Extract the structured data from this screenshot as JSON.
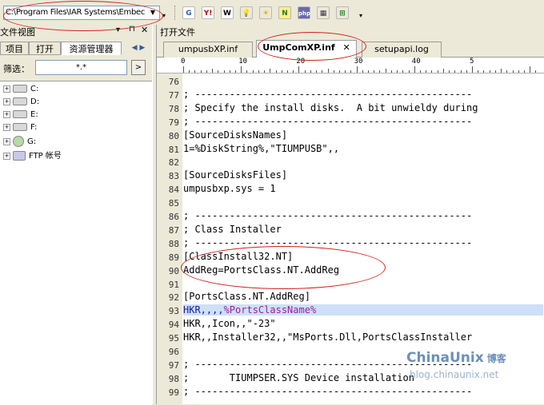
{
  "toolbar": {
    "path_value": "C:\\Program Files\\IAR Systems\\Embec",
    "icons": [
      {
        "name": "google-icon",
        "glyph": "G",
        "color": "#2a5db0",
        "bg": "#fff"
      },
      {
        "name": "yahoo-icon",
        "glyph": "Y!",
        "color": "#cc0000",
        "bg": "#fff"
      },
      {
        "name": "wikipedia-icon",
        "glyph": "W",
        "color": "#000",
        "bg": "#fff"
      },
      {
        "name": "lightbulb-icon",
        "glyph": "💡",
        "color": "#c8a000",
        "bg": "#ece9d8"
      },
      {
        "name": "weather-icon",
        "glyph": "☀",
        "color": "#e0a000",
        "bg": "#ece9d8"
      },
      {
        "name": "notes-icon",
        "glyph": "N",
        "color": "#2a7a2a",
        "bg": "#ffef8a"
      },
      {
        "name": "php-icon",
        "glyph": "php",
        "color": "#fff",
        "bg": "#6a6aa8"
      },
      {
        "name": "msdn-icon",
        "glyph": "▦",
        "color": "#334",
        "bg": "#ece9d8"
      },
      {
        "name": "windows-icon",
        "glyph": "⊞",
        "color": "#1a7a1a",
        "bg": "#ece9d8"
      }
    ]
  },
  "left_panel": {
    "title": "文件视图",
    "title_controls": [
      "▾",
      "⊓",
      "✕"
    ],
    "tabs": [
      "项目",
      "打开",
      "资源管理器"
    ],
    "nav_arrows": "◀ ▶",
    "filter_label": "筛选：",
    "filter_value": "*.*",
    "filter_button": ">",
    "tree": [
      {
        "label": "C:",
        "type": "drive"
      },
      {
        "label": "D:",
        "type": "drive"
      },
      {
        "label": "E:",
        "type": "drive"
      },
      {
        "label": "F:",
        "type": "drive"
      },
      {
        "label": "G:",
        "type": "network"
      },
      {
        "label": "FTP 帐号",
        "type": "ftp"
      }
    ]
  },
  "right_panel": {
    "title": "打开文件",
    "tabs": [
      {
        "label": "umpusbXP.inf",
        "active": false
      },
      {
        "label": "UmpComXP.inf",
        "active": true,
        "close": "✕"
      },
      {
        "label": "setupapi.log",
        "active": false
      }
    ],
    "ruler_labels": [
      "0",
      "10",
      "20",
      "30",
      "40",
      "5"
    ],
    "lines": [
      {
        "n": "76",
        "text": ""
      },
      {
        "n": "77",
        "text": "; ------------------------------------------------"
      },
      {
        "n": "78",
        "text": "; Specify the install disks.  A bit unwieldy during"
      },
      {
        "n": "79",
        "text": "; ------------------------------------------------"
      },
      {
        "n": "80",
        "text": "[SourceDisksNames]"
      },
      {
        "n": "81",
        "text": "1=%DiskString%,\"TIUMPUSB\",,"
      },
      {
        "n": "82",
        "text": ""
      },
      {
        "n": "83",
        "text": "[SourceDisksFiles]"
      },
      {
        "n": "84",
        "text": "umpusbxp.sys = 1"
      },
      {
        "n": "85",
        "text": ""
      },
      {
        "n": "86",
        "text": "; ------------------------------------------------"
      },
      {
        "n": "87",
        "text": "; Class Installer"
      },
      {
        "n": "88",
        "text": "; ------------------------------------------------"
      },
      {
        "n": "89",
        "text": "[ClassInstall32.NT]"
      },
      {
        "n": "90",
        "text": "AddReg=PortsClass.NT.AddReg"
      },
      {
        "n": "91",
        "text": ""
      },
      {
        "n": "92",
        "text": "[PortsClass.NT.AddReg]"
      },
      {
        "n": "93",
        "text": "HKR,,,,%PortsClassName%",
        "highlight": true
      },
      {
        "n": "94",
        "text": "HKR,,Icon,,\"-23\""
      },
      {
        "n": "95",
        "text": "HKR,,Installer32,,\"MsPorts.Dll,PortsClassInstaller"
      },
      {
        "n": "96",
        "text": ""
      },
      {
        "n": "97",
        "text": "; ------------------------------------------------"
      },
      {
        "n": "98",
        "text": ";       TIUMPSER.SYS Device installation"
      },
      {
        "n": "99",
        "text": "; ------------------------------------------------"
      }
    ]
  },
  "watermark": {
    "line1": "ChinaUnix",
    "line1_cn": "博客",
    "line2": "blog.chinaunix.net"
  }
}
